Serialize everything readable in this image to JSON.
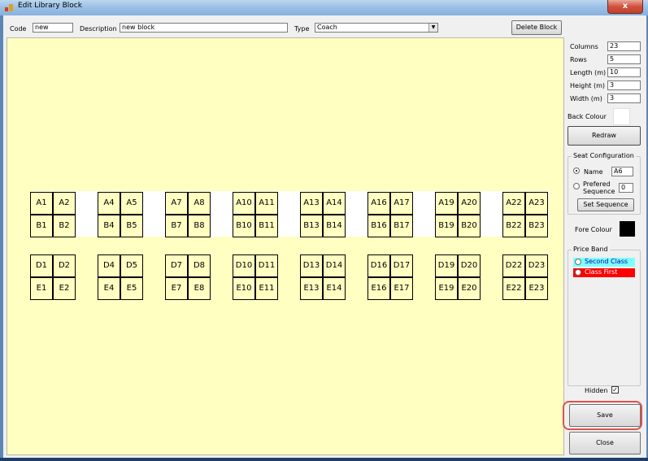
{
  "window": {
    "title": "Edit Library Block",
    "close_glyph": "x"
  },
  "header": {
    "code_label": "Code",
    "code_value": "new",
    "description_label": "Description",
    "description_value": "new block",
    "type_label": "Type",
    "type_value": "Coach",
    "delete_button": "Delete Block",
    "delete_mnemonic": "D"
  },
  "side": {
    "columns_label": "Columns",
    "columns_value": "23",
    "rows_label": "Rows",
    "rows_value": "5",
    "length_label": "Length (m)",
    "length_value": "10",
    "height_label": "Height (m)",
    "height_value": "3",
    "width_label": "Width (m)",
    "width_value": "3",
    "back_colour_label": "Back Colour",
    "redraw_button": "Redraw",
    "seat_config_legend": "Seat Configuration",
    "name_option": "Name",
    "name_value": "A6",
    "preferred_option_line1": "Prefered",
    "preferred_option_line2": "Sequence",
    "preferred_value": "0",
    "set_sequence_button": "Set Sequence",
    "fore_colour_label": "Fore Colour",
    "price_band_legend": "Price Band",
    "price_bands": [
      {
        "label": "Second Class",
        "color": "#7fffff"
      },
      {
        "label": "Class First",
        "color": "#ff0000"
      }
    ],
    "hidden_label": "Hidden",
    "hidden_checked": true,
    "save_button": "Save",
    "close_button": "Close"
  },
  "colors": {
    "canvas": "#ffffc1",
    "back_colour": "#ffffff",
    "fore_colour": "#000000",
    "highlight": "#d9534f"
  },
  "seat_groups": [
    [
      "A1",
      "A2",
      "B1",
      "B2",
      "D1",
      "D2",
      "E1",
      "E2"
    ],
    [
      "A4",
      "A5",
      "B4",
      "B5",
      "D4",
      "D5",
      "E4",
      "E5"
    ],
    [
      "A7",
      "A8",
      "B7",
      "B8",
      "D7",
      "D8",
      "E7",
      "E8"
    ],
    [
      "A10",
      "A11",
      "B10",
      "B11",
      "D10",
      "D11",
      "E10",
      "E11"
    ],
    [
      "A13",
      "A14",
      "B13",
      "B14",
      "D13",
      "D14",
      "E13",
      "E14"
    ],
    [
      "A16",
      "A17",
      "B16",
      "B17",
      "D16",
      "D17",
      "E16",
      "E17"
    ],
    [
      "A19",
      "A20",
      "B19",
      "B20",
      "D19",
      "D20",
      "E19",
      "E20"
    ],
    [
      "A22",
      "A23",
      "B22",
      "B23",
      "D22",
      "D23",
      "E22",
      "E23"
    ]
  ]
}
